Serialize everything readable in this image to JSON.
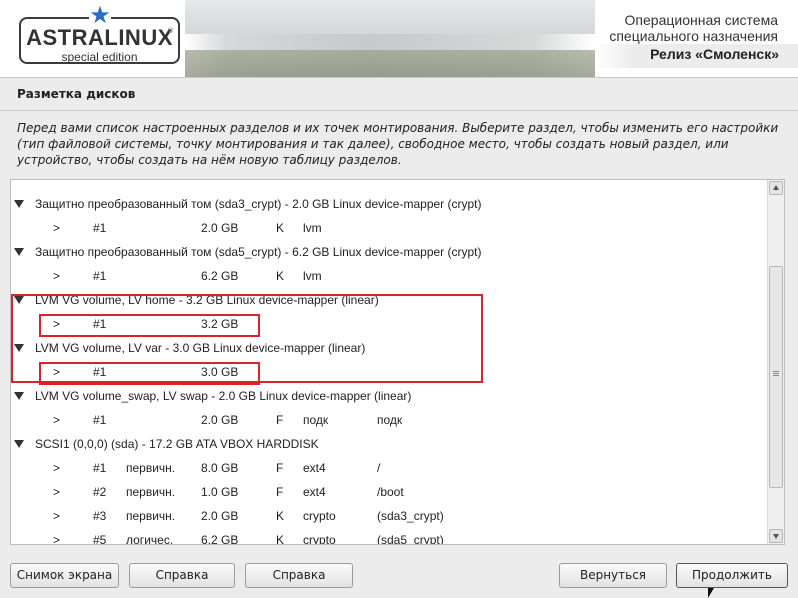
{
  "header": {
    "logo_title": "ASTRALINUX",
    "logo_registered": "®",
    "logo_subtitle": "special edition",
    "os_line1": "Операционная система",
    "os_line2": "специального назначения",
    "release": "Релиз «Смоленск»",
    "accent_color": "#2b6cc4"
  },
  "page": {
    "title": "Разметка дисков",
    "description": [
      "Перед вами список настроенных разделов и их точек монтирования. Выберите раздел, чтобы изменить его настройки",
      "(тип файловой системы, точку монтирования и так далее), свободное место, чтобы создать новый раздел, или",
      "устройство, чтобы создать на нём новую таблицу разделов."
    ]
  },
  "partitions": {
    "groups": [
      {
        "label": "Защитно   преобразованный  том  (sda3_crypt) - 2.0 GB Linux device-mapper (crypt)",
        "rows": [
          {
            "arrow": ">",
            "num": "#1",
            "type": "",
            "size": "2.0 GB",
            "flag": "K",
            "fs": "lvm",
            "mount": ""
          }
        ]
      },
      {
        "label": "Защитно   преобразованный  том  (sda5_crypt) - 6.2 GB Linux device-mapper (crypt)",
        "rows": [
          {
            "arrow": ">",
            "num": "#1",
            "type": "",
            "size": "6.2 GB",
            "flag": "K",
            "fs": "lvm",
            "mount": ""
          }
        ]
      },
      {
        "label": "LVM VG volume, LV home - 3.2 GB Linux device-mapper (linear)",
        "rows": [
          {
            "arrow": ">",
            "num": "#1",
            "type": "",
            "size": "3.2 GB",
            "flag": "",
            "fs": "",
            "mount": ""
          }
        ]
      },
      {
        "label": "LVM VG volume, LV var - 3.0 GB Linux device-mapper (linear)",
        "rows": [
          {
            "arrow": ">",
            "num": "#1",
            "type": "",
            "size": "3.0 GB",
            "flag": "",
            "fs": "",
            "mount": ""
          }
        ]
      },
      {
        "label": "LVM VG volume_swap, LV swap - 2.0 GB Linux device-mapper (linear)",
        "rows": [
          {
            "arrow": ">",
            "num": "#1",
            "type": "",
            "size": "2.0 GB",
            "flag": "F",
            "fs": "подк",
            "mount": "подк"
          }
        ]
      },
      {
        "label": "SCSI1 (0,0,0) (sda) - 17.2 GB ATA VBOX HARDDISK",
        "rows": [
          {
            "arrow": ">",
            "num": "#1",
            "type": "первичн.",
            "size": "8.0 GB",
            "flag": "F",
            "fs": "ext4",
            "mount": "/"
          },
          {
            "arrow": ">",
            "num": "#2",
            "type": "первичн.",
            "size": "1.0 GB",
            "flag": "F",
            "fs": "ext4",
            "mount": "/boot"
          },
          {
            "arrow": ">",
            "num": "#3",
            "type": "первичн.",
            "size": "2.0 GB",
            "flag": "K",
            "fs": "crypto",
            "mount": "(sda3_crypt)"
          },
          {
            "arrow": ">",
            "num": "#5",
            "type": "логичес.",
            "size": "6.2 GB",
            "flag": "K",
            "fs": "crypto",
            "mount": "(sda5_crypt)"
          }
        ]
      }
    ],
    "highlight_color": "#d9232d"
  },
  "buttons": {
    "screenshot": "Снимок экрана",
    "help1": "Справка",
    "help2": "Справка",
    "back": "Вернуться",
    "continue": "Продолжить"
  }
}
